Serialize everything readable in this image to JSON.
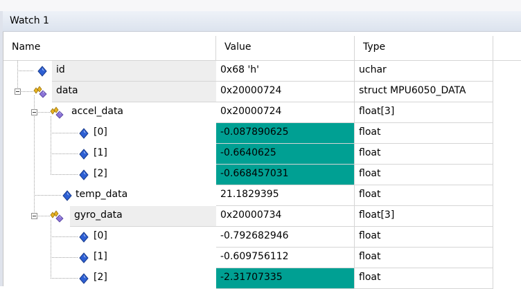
{
  "window": {
    "title": "Watch 1"
  },
  "columns": {
    "name": "Name",
    "value": "Value",
    "type": "Type"
  },
  "colors": {
    "changed_value_bg": "#00a093",
    "name_highlight_bg": "#eeeeee",
    "member_icon": "#2255cc"
  },
  "rows": [
    {
      "name": "id",
      "value": "0x68 'h'",
      "type": "uchar",
      "icon": "variable-diamond-icon",
      "changed": false
    },
    {
      "name": "data",
      "value": "0x20000724",
      "type": "struct MPU6050_DATA",
      "icon": "struct-icon",
      "changed": false,
      "expanded": true
    },
    {
      "name": "accel_data",
      "value": "0x20000724",
      "type": "float[3]",
      "icon": "struct-icon",
      "changed": false,
      "expanded": true
    },
    {
      "name": "[0]",
      "value": "-0.087890625",
      "type": "float",
      "icon": "variable-diamond-icon",
      "changed": true
    },
    {
      "name": "[1]",
      "value": "-0.6640625",
      "type": "float",
      "icon": "variable-diamond-icon",
      "changed": true
    },
    {
      "name": "[2]",
      "value": "-0.668457031",
      "type": "float",
      "icon": "variable-diamond-icon",
      "changed": true
    },
    {
      "name": "temp_data",
      "value": "21.1829395",
      "type": "float",
      "icon": "variable-diamond-icon",
      "changed": false
    },
    {
      "name": "gyro_data",
      "value": "0x20000734",
      "type": "float[3]",
      "icon": "struct-icon",
      "changed": false,
      "expanded": true
    },
    {
      "name": "[0]",
      "value": "-0.792682946",
      "type": "float",
      "icon": "variable-diamond-icon",
      "changed": false
    },
    {
      "name": "[1]",
      "value": "-0.609756112",
      "type": "float",
      "icon": "variable-diamond-icon",
      "changed": false
    },
    {
      "name": "[2]",
      "value": "-2.31707335",
      "type": "float",
      "icon": "variable-diamond-icon",
      "changed": true
    }
  ]
}
